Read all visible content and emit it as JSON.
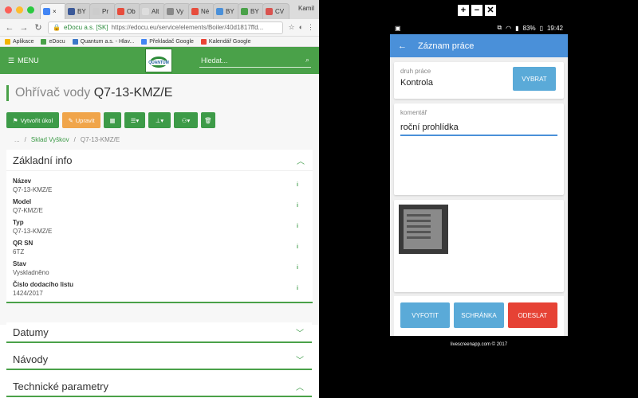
{
  "browser": {
    "user": "Kamil",
    "tabs": [
      "×",
      "BY",
      "Pr",
      "Ob",
      "Alt",
      "Vy",
      "Né",
      "BY",
      "BY",
      "CV"
    ],
    "tab_colors": [
      "#4285f4",
      "#3b5998",
      "#ccc",
      "#e74c3c",
      "#ddd",
      "#888",
      "#e74c3c",
      "#4a90d9",
      "#4aa149",
      "#d9534f"
    ],
    "address": {
      "secure": "eDocu a.s. [SK]",
      "url": "https://edocu.eu/service/elements/Boiler/40d1817ffd..."
    },
    "bookmarks": [
      "Aplikace",
      "eDocu",
      "Quantum a.s. - Hlav...",
      "Překladač Google",
      "Kalendář Google"
    ]
  },
  "app": {
    "menu_label": "MENU",
    "logo_text": "QUANTUM",
    "search_placeholder": "Hledat...",
    "title_prefix": "Ohřívač vody",
    "title_model": "Q7-13-KMZ/E",
    "actions": {
      "create_task": "Vytvořit úkol",
      "edit": "Upravit"
    },
    "breadcrumb": {
      "root": "...",
      "parent": "Sklad Vyškov",
      "current": "Q7-13-KMZ/E"
    },
    "basic_info": {
      "title": "Základní info",
      "fields": [
        {
          "label": "Název",
          "value": "Q7-13-KMZ/E"
        },
        {
          "label": "Model",
          "value": "Q7-KMZ/E"
        },
        {
          "label": "Typ",
          "value": "Q7-13-KMZ/E"
        },
        {
          "label": "QR SN",
          "value": "6TZ"
        },
        {
          "label": "Stav",
          "value": "Vyskladněno"
        },
        {
          "label": "Číslo dodacího listu",
          "value": "1424/2017"
        }
      ]
    },
    "sections": [
      "Datumy",
      "Návody",
      "Technické parametry"
    ]
  },
  "phone": {
    "status": {
      "battery": "83%",
      "time": "19:42"
    },
    "title": "Záznam práce",
    "work_type_label": "druh práce",
    "work_type_value": "Kontrola",
    "select_button": "VYBRAT",
    "comment_label": "komentář",
    "comment_value": "roční prohlídka",
    "buttons": {
      "photo": "VYFOTIT",
      "clipboard": "SCHRÁNKA",
      "send": "ODESLAT"
    }
  },
  "footer_credit": "livescreenapp.com © 2017",
  "colors": {
    "brand_green": "#4aa149",
    "phone_blue": "#4a90d9",
    "send_red": "#e64235",
    "edit_orange": "#f0a54a"
  }
}
